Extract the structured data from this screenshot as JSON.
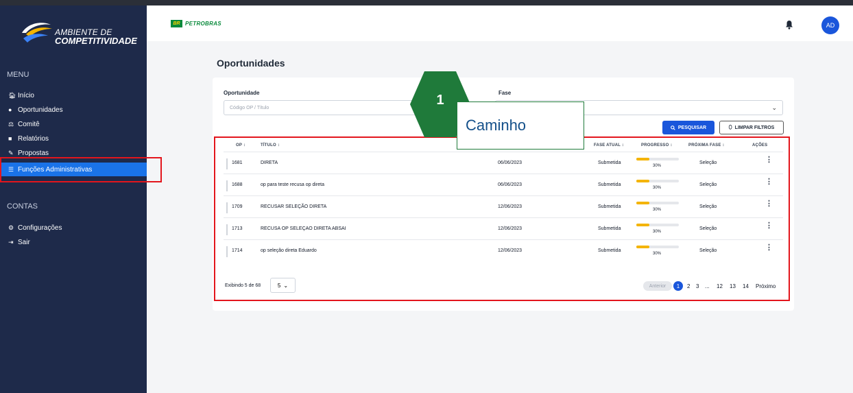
{
  "logo": {
    "line1": "AMBIENTE DE",
    "line2": "COMPETITIVIDADE"
  },
  "sidebar": {
    "menu_heading": "MENU",
    "items": [
      {
        "label": "Início",
        "icon": "home-icon"
      },
      {
        "label": "Oportunidades",
        "icon": "lightbulb-icon"
      },
      {
        "label": "Comitê",
        "icon": "scale-icon"
      },
      {
        "label": "Relatórios",
        "icon": "report-icon"
      },
      {
        "label": "Propostas",
        "icon": "proposal-icon"
      },
      {
        "label": "Funções Administrativas",
        "icon": "list-icon",
        "active": true
      }
    ],
    "accounts_heading": "CONTAS",
    "account_items": [
      {
        "label": "Configurações",
        "icon": "gear-icon"
      },
      {
        "label": "Sair",
        "icon": "logout-icon"
      }
    ]
  },
  "header": {
    "brand_badge": "BR",
    "brand": "PETROBRAS",
    "avatar": "AD"
  },
  "page": {
    "title": "Oportunidades"
  },
  "filters": {
    "oportunidade_label": "Oportunidade",
    "oportunidade_placeholder": "Código OP / Título",
    "fase_label": "Fase",
    "search_button": "PESQUISAR",
    "clear_button": "LIMPAR FILTROS"
  },
  "table": {
    "headers": {
      "op": "OP",
      "titulo": "TÍTULO",
      "fase_atual": "FASE ATUAL",
      "progresso": "PROGRESSO",
      "proxima_fase": "PRÓXIMA FASE",
      "acoes": "AÇÕES"
    },
    "rows": [
      {
        "op": "1681",
        "titulo": "DIRETA",
        "data": "06/06/2023",
        "fase": "Submetida",
        "progresso": 30,
        "progresso_label": "30%",
        "proxima": "Seleção"
      },
      {
        "op": "1688",
        "titulo": "op para teste recusa op direta",
        "data": "06/06/2023",
        "fase": "Submetida",
        "progresso": 30,
        "progresso_label": "30%",
        "proxima": "Seleção"
      },
      {
        "op": "1709",
        "titulo": "RECUSAR SELEÇÃO DIRETA",
        "data": "12/06/2023",
        "fase": "Submetida",
        "progresso": 30,
        "progresso_label": "30%",
        "proxima": "Seleção"
      },
      {
        "op": "1713",
        "titulo": "RECUSA OP SELEÇAO DIRETA ABSAI",
        "data": "12/06/2023",
        "fase": "Submetida",
        "progresso": 30,
        "progresso_label": "30%",
        "proxima": "Seleção"
      },
      {
        "op": "1714",
        "titulo": "op seleção direta Eduardo",
        "data": "12/06/2023",
        "fase": "Submetida",
        "progresso": 30,
        "progresso_label": "30%",
        "proxima": "Seleção"
      }
    ]
  },
  "footer": {
    "showing": "Exibindo 5 de 68",
    "page_size": "5",
    "prev": "Anterior",
    "pages": [
      "1",
      "2",
      "3",
      "...",
      "12",
      "13",
      "14"
    ],
    "next": "Próximo"
  },
  "annotation": {
    "step": "1",
    "callout": "Caminho"
  },
  "colors": {
    "sidebar": "#1e2a4a",
    "accent": "#1a56db",
    "active_nav": "#1a73e8",
    "progress": "#f4b400",
    "highlight": "#e3151c",
    "step_green": "#1f7a3a"
  }
}
